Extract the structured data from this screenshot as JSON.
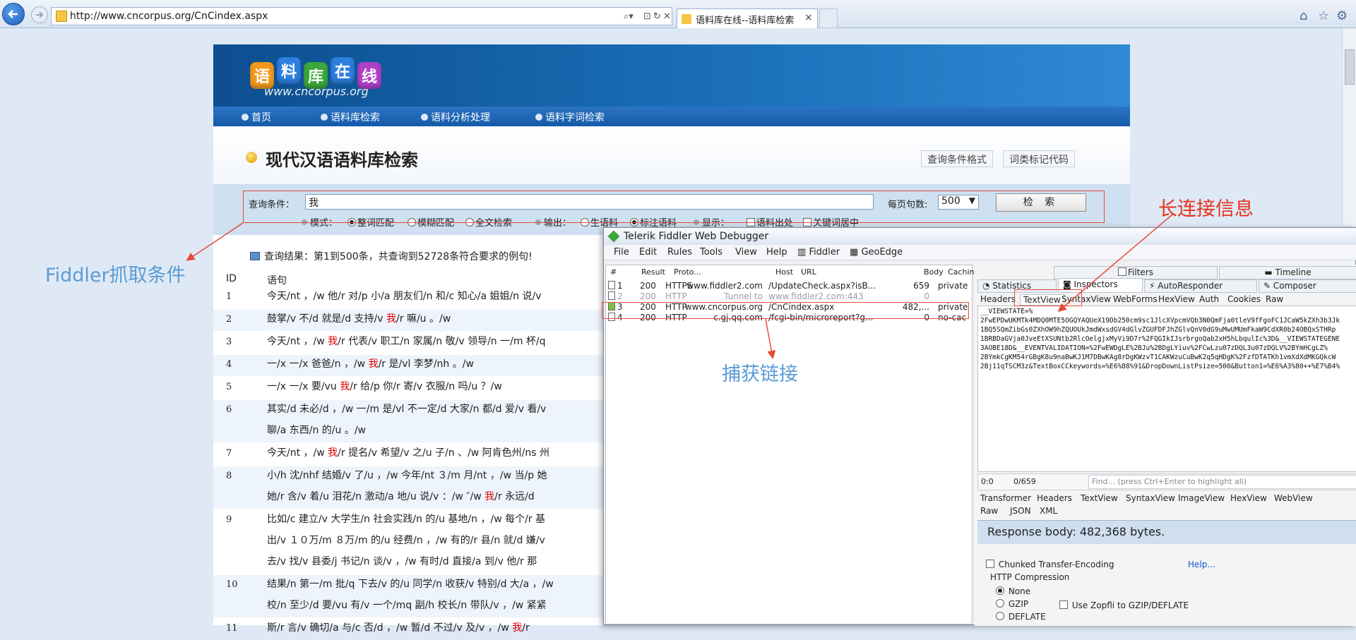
{
  "browser": {
    "url": "http://www.cncorpus.org/CnCindex.aspx",
    "tab_title": "语料库在线--语料库检索",
    "tab_close": "×",
    "icons": [
      "back-icon",
      "forward-icon",
      "search-icon",
      "refresh-icon",
      "home-icon",
      "star-icon",
      "gear-icon"
    ]
  },
  "site": {
    "logo_chars": [
      "语",
      "料",
      "库",
      "在",
      "线"
    ],
    "logo_sub": "www.cncorpus.org",
    "menu": [
      "首页",
      "语料库检索",
      "语料分析处理",
      "语料字词检索"
    ],
    "page_title": "现代汉语语料库检索",
    "title_buttons": [
      "查询条件格式",
      "词类标记代码"
    ]
  },
  "query": {
    "label": "查询条件：",
    "value": "我",
    "per_page_label": "每页句数:",
    "per_page_value": "500",
    "button": "检 索",
    "mode_label": "模式：",
    "modes": [
      "整词匹配",
      "模糊匹配",
      "全文检索"
    ],
    "output_label": "输出：",
    "outputs": [
      "生语料",
      "标注语料"
    ],
    "display_label": "显示：",
    "displays": [
      "语料出处",
      "关键词居中"
    ]
  },
  "results": {
    "summary": "查询结果：第1到500条，共查询到52728条符合要求的例句!",
    "col_id": "ID",
    "col_sentence": "语句",
    "rows": [
      {
        "id": "1",
        "lines": [
          [
            "今天/nt ，/w 他/r 对/p 小/a 朋友们/n 和/c 知心/a 姐姐/n 说/v",
            "",
            ""
          ]
        ]
      },
      {
        "id": "2",
        "lines": [
          [
            "鼓掌/v 不/d 就是/d 支持/v ",
            "我",
            "/r 嘛/u 。/w"
          ]
        ]
      },
      {
        "id": "3",
        "lines": [
          [
            "今天/nt ，/w ",
            "我",
            "/r 代表/v 职工/n 家属/n 敬/v 领导/n 一/m 杯/q"
          ]
        ]
      },
      {
        "id": "4",
        "lines": [
          [
            "一/x 一/x 爸爸/n ，/w ",
            "我",
            "/r 是/vl 李梦/nh 。/w"
          ]
        ]
      },
      {
        "id": "5",
        "lines": [
          [
            "一/x 一/x 要/vu ",
            "我",
            "/r 给/p 你/r 寄/v 衣服/n 吗/u ？/w"
          ]
        ]
      },
      {
        "id": "6",
        "lines": [
          [
            "其实/d 未必/d ，/w 一/m 是/vl 不一定/d 大家/n 都/d 爱/v 看/v",
            "",
            ""
          ],
          [
            "聊/a 东西/n 的/u 。/w",
            "",
            ""
          ]
        ]
      },
      {
        "id": "7",
        "lines": [
          [
            "今天/nt ，/w ",
            "我",
            "/r 提名/v 希望/v 之/u 子/n 、/w 阿肯色州/ns 州"
          ]
        ]
      },
      {
        "id": "8",
        "lines": [
          [
            "小/h 沈/nhf 结婚/v 了/u ，/w 今年/nt ３/m 月/nt ，/w 当/p 她",
            "",
            ""
          ],
          [
            "她/r 含/v 着/u 泪花/n 激动/a 地/u 说/v ：/w ″/w ",
            "我",
            "/r 永远/d"
          ]
        ]
      },
      {
        "id": "9",
        "lines": [
          [
            "比如/c 建立/v 大学生/n 社会实践/n 的/u 基地/n ，/w 每个/r 基",
            "",
            ""
          ],
          [
            "出/v １０万/m ８万/m 的/u 经费/n ，/w 有的/r 县/n 就/d 嫌/v",
            "",
            ""
          ],
          [
            "去/v 找/v 县委/j 书记/n 谈/v ，/w 有时/d 直接/a 到/v 他/r 那",
            "",
            ""
          ]
        ]
      },
      {
        "id": "10",
        "lines": [
          [
            "结果/n 第一/m 批/q 下去/v 的/u 同学/n 收获/v 特别/d 大/a ，/w",
            "",
            ""
          ],
          [
            "校/n 至少/d 要/vu 有/v 一个/mq 副/h 校长/n 带队/v ，/w 紧紧",
            "",
            ""
          ]
        ]
      },
      {
        "id": "11",
        "lines": [
          [
            "斯/r 言/v 确切/a 与/c 否/d ，/w 暂/d 不过/v 及/v ，/w ",
            "我",
            "/r"
          ]
        ]
      }
    ]
  },
  "annotations": {
    "fiddler_condition": "Fiddler抓取条件",
    "long_connection": "长连接信息",
    "captured_link": "捕获链接"
  },
  "fiddler": {
    "title": "Telerik Fiddler Web Debugger",
    "menu": [
      "File",
      "Edit",
      "Rules",
      "Tools",
      "View",
      "Help",
      "Fiddler",
      "GeoEdge"
    ],
    "columns": [
      "#",
      "Result",
      "Proto...",
      "Host",
      "URL",
      "Body",
      "Cachin"
    ],
    "sessions": [
      {
        "num": "1",
        "result": "200",
        "proto": "HTTPS",
        "host": "www.fiddler2.com",
        "url": "/UpdateCheck.aspx?isB...",
        "body": "659",
        "cache": "private",
        "dim": false
      },
      {
        "num": "2",
        "result": "200",
        "proto": "HTTP",
        "host": "Tunnel to",
        "url": "www.fiddler2.com:443",
        "body": "0",
        "cache": "",
        "dim": true
      },
      {
        "num": "3",
        "result": "200",
        "proto": "HTTP",
        "host": "www.cncorpus.org",
        "url": "/CnCindex.aspx",
        "body": "482,...",
        "cache": "private",
        "dim": false
      },
      {
        "num": "4",
        "result": "200",
        "proto": "HTTP",
        "host": "c.gj.qq.com",
        "url": "/fcgi-bin/microreport?g...",
        "body": "0",
        "cache": "no-cac",
        "dim": false
      }
    ],
    "top_tabs_row1": [
      "Filters",
      "Timeline"
    ],
    "top_tabs_row2": [
      "Statistics",
      "Inspectors",
      "AutoResponder",
      "Composer"
    ],
    "request_tabs": [
      "Headers",
      "TextView",
      "SyntaxView",
      "WebForms",
      "HexView",
      "Auth",
      "Cookies",
      "Raw"
    ],
    "request_body": [
      "__VIEWSTATE=%",
      "2FwEPDwUKMTk4MDQ0MTE5OGQYAQUeX19Db250cm9sc1JlcXVpcmVQb3N0QmFja0tleV9fFgoFC1JCaW5kZXh3b3Jk",
      "1BQ5SQmZibGs0ZXhOW9hZQUOUkJmdWxsdGV4dGlvZGUFDFJhZGlvQnV0dG9uMwUMUmFkaW9CdXR0b24OBQxSTHRp",
      "1BRBDaGVja0JveEtXSUNtb2RlcOelgjxMyVi9D7r%2FQGIkIJsrbrgoQab2xH5hLbqulIc%3D&__VIEWSTATEGENE",
      "3AOBE18D&__EVENTVALIDATION=%2FwEWDgLE%2BJu%2BDgLYiuv%2FCwLzu07zDQL3u07zDQLV%2BYmHCgLZ%",
      "2BYmkCgKM54rGBgK8u9naBwKJ1M7DBwKAg8rDgKWzvT1CAKWzuCuBwK2q5qHDgK%2FzfDTATKh1vmXdXdMKGQkcW",
      "2Bj11qTSCM3z&TextBoxCCkeywords=%E6%88%91&DropDownListPsize=500&Button1=%E6%A3%80++%E7%B4%"
    ],
    "status_pos": "0:0",
    "status_len": "0/659",
    "find_placeholder": "Find... (press Ctrl+Enter to highlight all)",
    "response_tabs": [
      "Transformer",
      "Headers",
      "TextView",
      "SyntaxView",
      "ImageView",
      "HexView",
      "WebView"
    ],
    "response_tabs2": [
      "Raw",
      "JSON",
      "XML"
    ],
    "response_body": "Response body: 482,368 bytes.",
    "chunked": "Chunked Transfer-Encoding",
    "help": "Help...",
    "compression_label": "HTTP Compression",
    "compression_opts": [
      "None",
      "GZIP",
      "DEFLATE"
    ],
    "zopfli": "Use Zopfli to GZIP/DEFLATE"
  }
}
